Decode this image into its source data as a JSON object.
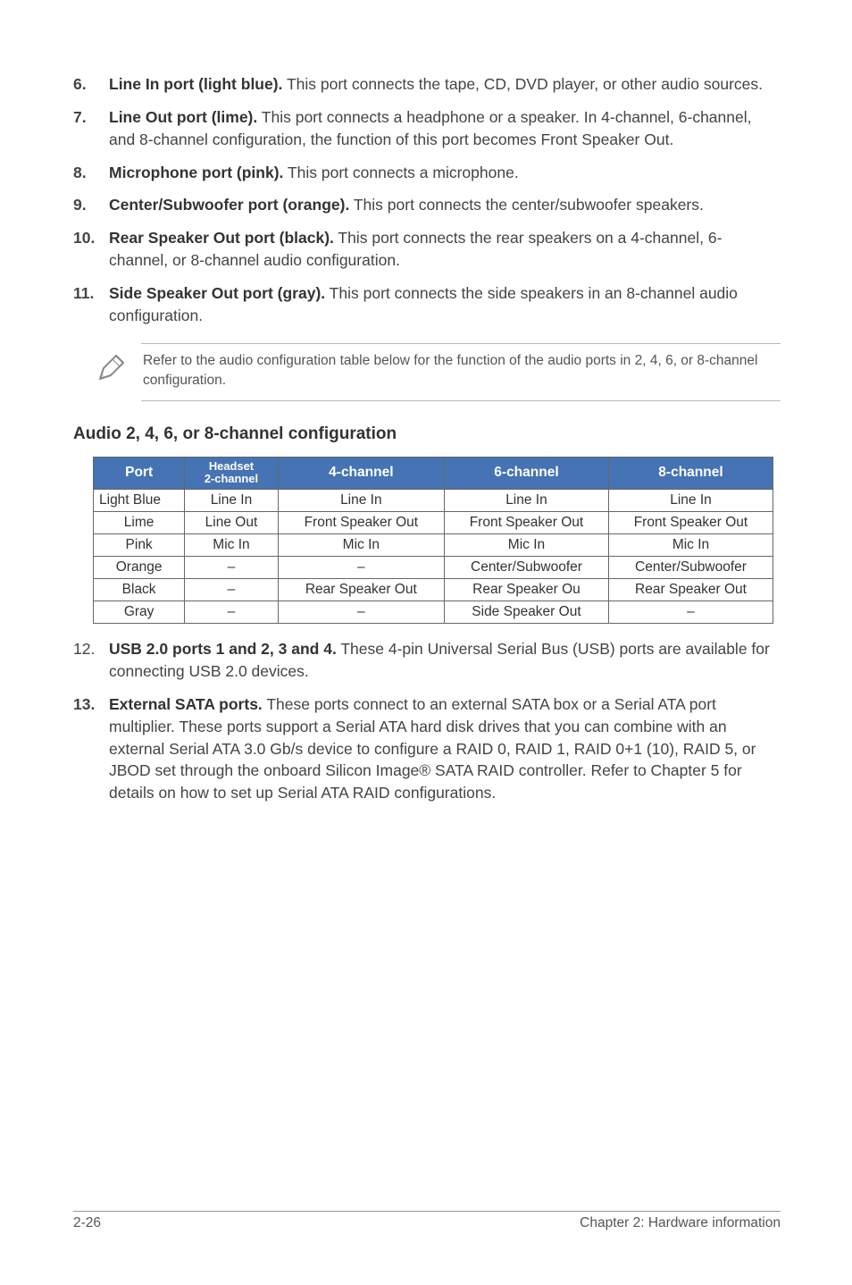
{
  "items": [
    {
      "num": "6.",
      "bold": "Line In port (light blue).",
      "rest": " This port connects the tape, CD, DVD player, or other audio sources."
    },
    {
      "num": "7.",
      "bold": "Line Out port (lime).",
      "rest": " This port connects a headphone or a speaker. In 4-channel, 6-channel, and 8-channel configuration, the function of this port becomes Front Speaker Out."
    },
    {
      "num": "8.",
      "bold": "Microphone port (pink).",
      "rest": " This port connects a microphone."
    },
    {
      "num": "9.",
      "bold": "Center/Subwoofer port (orange).",
      "rest": " This port connects the center/subwoofer speakers."
    },
    {
      "num": "10.",
      "bold": "Rear Speaker Out port (black).",
      "rest": " This port connects the rear speakers on a 4-channel, 6-channel, or 8-channel audio configuration."
    },
    {
      "num": "11.",
      "bold": "Side Speaker Out port (gray).",
      "rest": " This port connects the side speakers in an 8-channel audio configuration."
    }
  ],
  "note_text": "Refer to the audio configuration table below for the function of the audio ports in 2, 4, 6, or 8-channel configuration.",
  "table_heading": "Audio 2, 4, 6, or 8-channel configuration",
  "table_headers": {
    "port": "Port",
    "headset1": "Headset",
    "headset2": "2-channel",
    "ch4": "4-channel",
    "ch6": "6-channel",
    "ch8": "8-channel"
  },
  "table_rows": [
    {
      "port": "Light Blue",
      "h2": "Line In",
      "c4": "Line In",
      "c6": "Line In",
      "c8": "Line In"
    },
    {
      "port": "Lime",
      "h2": "Line Out",
      "c4": "Front Speaker Out",
      "c6": "Front Speaker Out",
      "c8": "Front Speaker Out"
    },
    {
      "port": "Pink",
      "h2": "Mic In",
      "c4": "Mic In",
      "c6": "Mic In",
      "c8": "Mic In"
    },
    {
      "port": "Orange",
      "h2": "–",
      "c4": "–",
      "c6": "Center/Subwoofer",
      "c8": "Center/Subwoofer"
    },
    {
      "port": "Black",
      "h2": "–",
      "c4": "Rear Speaker Out",
      "c6": "Rear Speaker Ou",
      "c8": "Rear Speaker Out"
    },
    {
      "port": "Gray",
      "h2": "–",
      "c4": "–",
      "c6": "Side Speaker Out",
      "c8": "–"
    }
  ],
  "lower_items": [
    {
      "num": "12.",
      "bold": "USB 2.0 ports 1 and 2, 3 and 4.",
      "rest": " These 4-pin Universal Serial Bus (USB) ports are available for connecting USB 2.0 devices."
    },
    {
      "num": "13.",
      "bold": "External SATA ports.",
      "rest": " These ports connect to an external SATA box or a Serial ATA port multiplier. These ports support a Serial ATA hard disk drives that you can combine with an external Serial ATA 3.0 Gb/s device to configure a RAID 0, RAID 1, RAID 0+1 (10), RAID 5, or JBOD set through the onboard Silicon Image® SATA RAID controller. Refer to Chapter 5 for details on how to set up Serial ATA RAID configurations."
    }
  ],
  "footer_left": "2-26",
  "footer_right": "Chapter 2: Hardware information"
}
